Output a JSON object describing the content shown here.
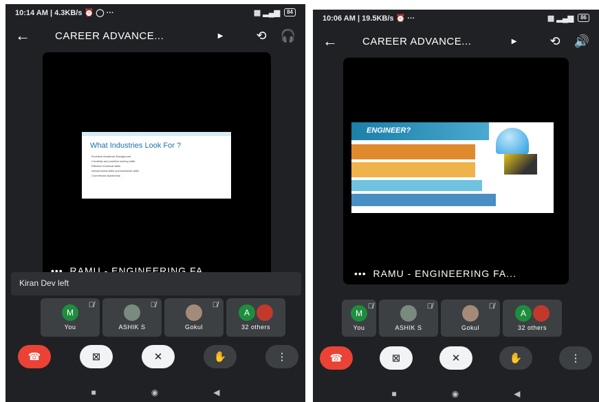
{
  "left": {
    "status": {
      "time": "10:14 AM | 4.3KB/s",
      "icons": "⏰ ◯ ···",
      "battery": "84"
    },
    "meeting_title": "CAREER ADVANCE...",
    "slide": {
      "title": "What Industries Look For ?",
      "bullets": [
        "Excellent Academic Background",
        "Creativity and problem solving skills",
        "Effective technical skills",
        "Interpersonal skills and teamwork skills",
        "Commercial awareness"
      ]
    },
    "presenter": "RAMU - ENGINEERING FA",
    "toast": "Kiran Dev left",
    "participants": [
      {
        "initial": "M",
        "name": "You",
        "color": "#1e8e3e"
      },
      {
        "initial": "",
        "name": "ASHIK S",
        "color": "#5f6368"
      },
      {
        "initial": "",
        "name": "Gokul",
        "color": "#5f6368"
      },
      {
        "initial": "A",
        "name": "32 others",
        "color": "#1e8e3e"
      }
    ]
  },
  "right": {
    "status": {
      "time": "10:06 AM | 19.5KB/s",
      "icons": "⏰ ···",
      "battery": "86"
    },
    "meeting_title": "CAREER ADVANCE...",
    "slide": {
      "title": "ENGINEER?"
    },
    "presenter": "RAMU - ENGINEERING FA...",
    "participants": [
      {
        "initial": "M",
        "name": "You",
        "color": "#1e8e3e"
      },
      {
        "initial": "",
        "name": "ASHIK S",
        "color": "#5f6368"
      },
      {
        "initial": "",
        "name": "Gokul",
        "color": "#5f6368"
      },
      {
        "initial": "A",
        "name": "32 others",
        "color": "#1e8e3e"
      }
    ]
  },
  "icons": {
    "back": "back-arrow-icon",
    "switch_camera": "switch-camera-icon",
    "audio_left": "headphones-icon",
    "audio_right": "speaker-icon",
    "end_call": "end-call-icon",
    "camera_off": "camera-off-icon",
    "mic_off": "mic-off-icon",
    "raise_hand": "raise-hand-icon",
    "more": "more-vert-icon"
  },
  "colors": {
    "end_call": "#ea4335",
    "background": "#202124",
    "tile": "#3c4043",
    "avatar_green": "#1e8e3e"
  }
}
